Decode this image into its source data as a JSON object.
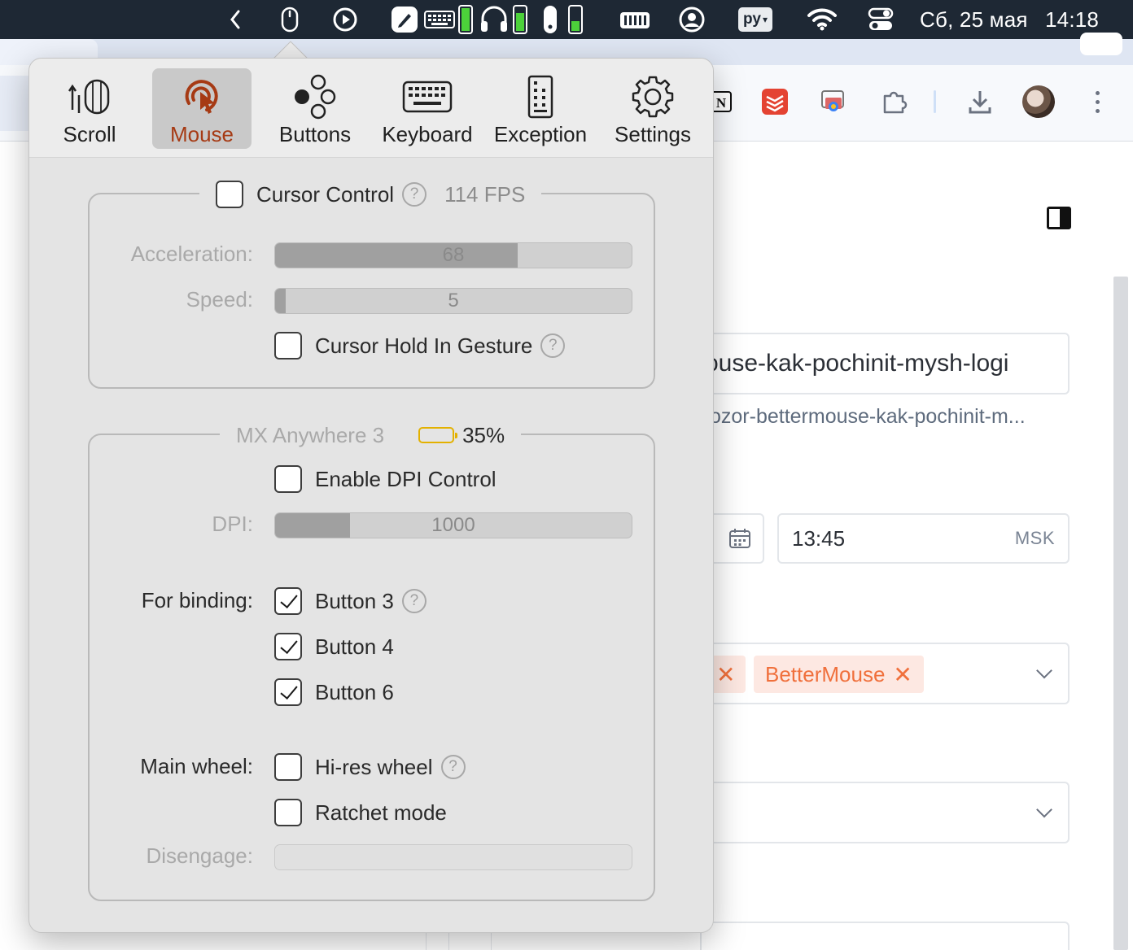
{
  "menubar": {
    "lang": "ру",
    "date": "Сб, 25 мая",
    "time": "14:18",
    "icons": [
      "chevron-left-icon",
      "mouse-icon",
      "play-icon",
      "pen-app-icon",
      "keyboard-icon",
      "battery-green-icon",
      "headphones-icon",
      "battery-green-icon",
      "mouse-small-icon",
      "battery-green-icon",
      "memory-icon",
      "user-icon",
      "language-icon",
      "wifi-icon",
      "control-center-icon"
    ]
  },
  "browser": {
    "toolbar_icons": [
      "notion-icon",
      "todoist-icon",
      "screenshot-icon",
      "extensions-icon",
      "download-icon",
      "avatar",
      "more-icon"
    ],
    "slug_value": "ouse-kak-pochinit-mysh-logi",
    "slug_hint": "ozor-bettermouse-kak-pochinit-m...",
    "time_value": "13:45",
    "time_zone": "MSK",
    "tag_label": "BetterMouse"
  },
  "popover": {
    "tabs": [
      {
        "label": "Scroll",
        "icon": "scroll-icon",
        "active": false
      },
      {
        "label": "Mouse",
        "icon": "mouse-cursor-icon",
        "active": true
      },
      {
        "label": "Buttons",
        "icon": "buttons-icon",
        "active": false
      },
      {
        "label": "Keyboard",
        "icon": "keyboard-icon",
        "active": false
      },
      {
        "label": "Exception",
        "icon": "exception-icon",
        "active": false
      },
      {
        "label": "Settings",
        "icon": "gear-icon",
        "active": false
      }
    ],
    "cursor": {
      "title": "Cursor Control",
      "fps": "114 FPS",
      "enabled": false,
      "acceleration_label": "Acceleration:",
      "acceleration_value": "68",
      "acceleration_fraction": 0.68,
      "speed_label": "Speed:",
      "speed_value": "5",
      "speed_fraction": 0.03,
      "hold_label": "Cursor Hold In Gesture",
      "hold_checked": false
    },
    "device": {
      "name": "MX Anywhere 3",
      "battery": "35%",
      "battery_fraction": 0.35,
      "battery_color": "#f5c400",
      "dpi_control_label": "Enable DPI Control",
      "dpi_control_checked": false,
      "dpi_label": "DPI:",
      "dpi_value": "1000",
      "dpi_fraction": 0.21,
      "binding_label": "For binding:",
      "binding": [
        {
          "label": "Button 3",
          "checked": true,
          "help": true
        },
        {
          "label": "Button 4",
          "checked": true,
          "help": false
        },
        {
          "label": "Button 6",
          "checked": true,
          "help": false
        }
      ],
      "wheel_label": "Main wheel:",
      "hires_label": "Hi-res wheel",
      "hires_checked": false,
      "ratchet_label": "Ratchet mode",
      "ratchet_checked": false,
      "disengage_label": "Disengage:"
    },
    "accent_color": "#a63a14"
  }
}
